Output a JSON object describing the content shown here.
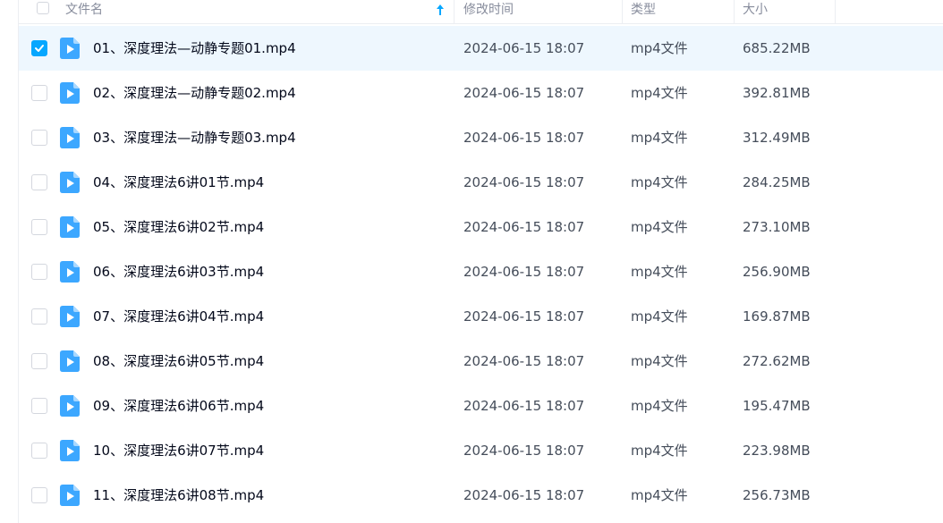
{
  "colors": {
    "accent": "#06a7ff",
    "selected_row_bg": "#eef7fe",
    "header_text": "#878c9c",
    "body_text": "#454d5a"
  },
  "header": {
    "name": "文件名",
    "modified": "修改时间",
    "type": "类型",
    "size": "大小",
    "sort_icon": "sort-ascending-arrow-icon"
  },
  "file_icon": "video-file-play-icon",
  "files": [
    {
      "name": "01、深度理法—动静专题01.mp4",
      "modified": "2024-06-15 18:07",
      "type": "mp4文件",
      "size": "685.22MB",
      "selected": true
    },
    {
      "name": "02、深度理法—动静专题02.mp4",
      "modified": "2024-06-15 18:07",
      "type": "mp4文件",
      "size": "392.81MB",
      "selected": false
    },
    {
      "name": "03、深度理法—动静专题03.mp4",
      "modified": "2024-06-15 18:07",
      "type": "mp4文件",
      "size": "312.49MB",
      "selected": false
    },
    {
      "name": "04、深度理法6讲01节.mp4",
      "modified": "2024-06-15 18:07",
      "type": "mp4文件",
      "size": "284.25MB",
      "selected": false
    },
    {
      "name": "05、深度理法6讲02节.mp4",
      "modified": "2024-06-15 18:07",
      "type": "mp4文件",
      "size": "273.10MB",
      "selected": false
    },
    {
      "name": "06、深度理法6讲03节.mp4",
      "modified": "2024-06-15 18:07",
      "type": "mp4文件",
      "size": "256.90MB",
      "selected": false
    },
    {
      "name": "07、深度理法6讲04节.mp4",
      "modified": "2024-06-15 18:07",
      "type": "mp4文件",
      "size": "169.87MB",
      "selected": false
    },
    {
      "name": "08、深度理法6讲05节.mp4",
      "modified": "2024-06-15 18:07",
      "type": "mp4文件",
      "size": "272.62MB",
      "selected": false
    },
    {
      "name": "09、深度理法6讲06节.mp4",
      "modified": "2024-06-15 18:07",
      "type": "mp4文件",
      "size": "195.47MB",
      "selected": false
    },
    {
      "name": "10、深度理法6讲07节.mp4",
      "modified": "2024-06-15 18:07",
      "type": "mp4文件",
      "size": "223.98MB",
      "selected": false
    },
    {
      "name": "11、深度理法6讲08节.mp4",
      "modified": "2024-06-15 18:07",
      "type": "mp4文件",
      "size": "256.73MB",
      "selected": false
    }
  ]
}
